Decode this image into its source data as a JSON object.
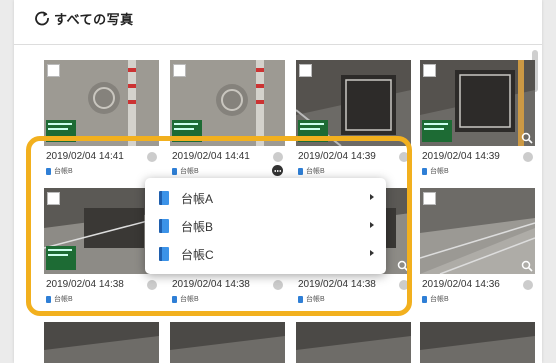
{
  "header": {
    "title": "すべての写真",
    "icon": "refresh-icon"
  },
  "photos": [
    {
      "date": "2019/02/04 14:41",
      "ledger": "台帳B",
      "scene": "floor-hole"
    },
    {
      "date": "2019/02/04 14:41",
      "ledger": "台帳B",
      "scene": "floor-hole"
    },
    {
      "date": "2019/02/04 14:39",
      "ledger": "台帳B",
      "scene": "floor-board"
    },
    {
      "date": "2019/02/04 14:39",
      "ledger": "台帳B",
      "scene": "floor-board"
    },
    {
      "date": "2019/02/04 14:38",
      "ledger": "台帳B",
      "scene": "worker"
    },
    {
      "date": "2019/02/04 14:38",
      "ledger": "台帳B",
      "scene": "worker"
    },
    {
      "date": "2019/02/04 14:38",
      "ledger": "台帳B",
      "scene": "worker"
    },
    {
      "date": "2019/02/04 14:36",
      "ledger": "台帳B",
      "scene": "worker"
    }
  ],
  "menu": {
    "items": [
      {
        "label": "台帳A"
      },
      {
        "label": "台帳B"
      },
      {
        "label": "台帳C"
      }
    ]
  },
  "colors": {
    "highlight": "#f2b01e",
    "book": "#2f7fd6",
    "status_dot": "#cccccc"
  }
}
